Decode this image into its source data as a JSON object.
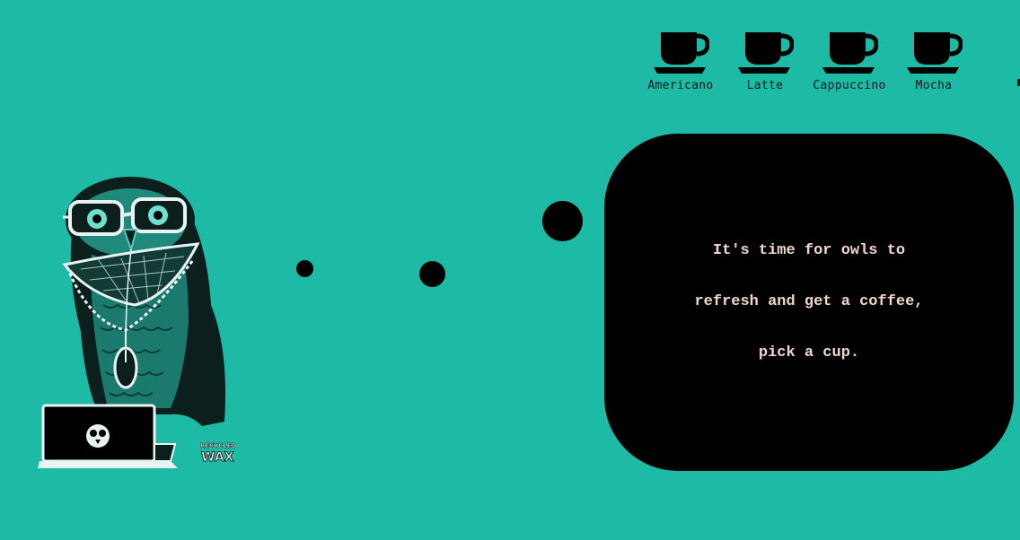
{
  "menu": {
    "items": [
      {
        "label": "Americano",
        "icon": "coffee-cup-icon"
      },
      {
        "label": "Latte",
        "icon": "coffee-cup-icon"
      },
      {
        "label": "Cappuccino",
        "icon": "coffee-cup-icon"
      },
      {
        "label": "Mocha",
        "icon": "coffee-cup-icon"
      }
    ]
  },
  "bubble": {
    "lines": [
      "It's time for owls to",
      "refresh and get a coffee,",
      "pick a cup."
    ]
  },
  "illustration": {
    "brand_text": "RECYCLED WAX",
    "icon": "owl-with-laptop-illustration"
  },
  "colors": {
    "background": "#1dbaa6",
    "bubble": "#000000",
    "bubble_text": "#f2d6cc"
  }
}
